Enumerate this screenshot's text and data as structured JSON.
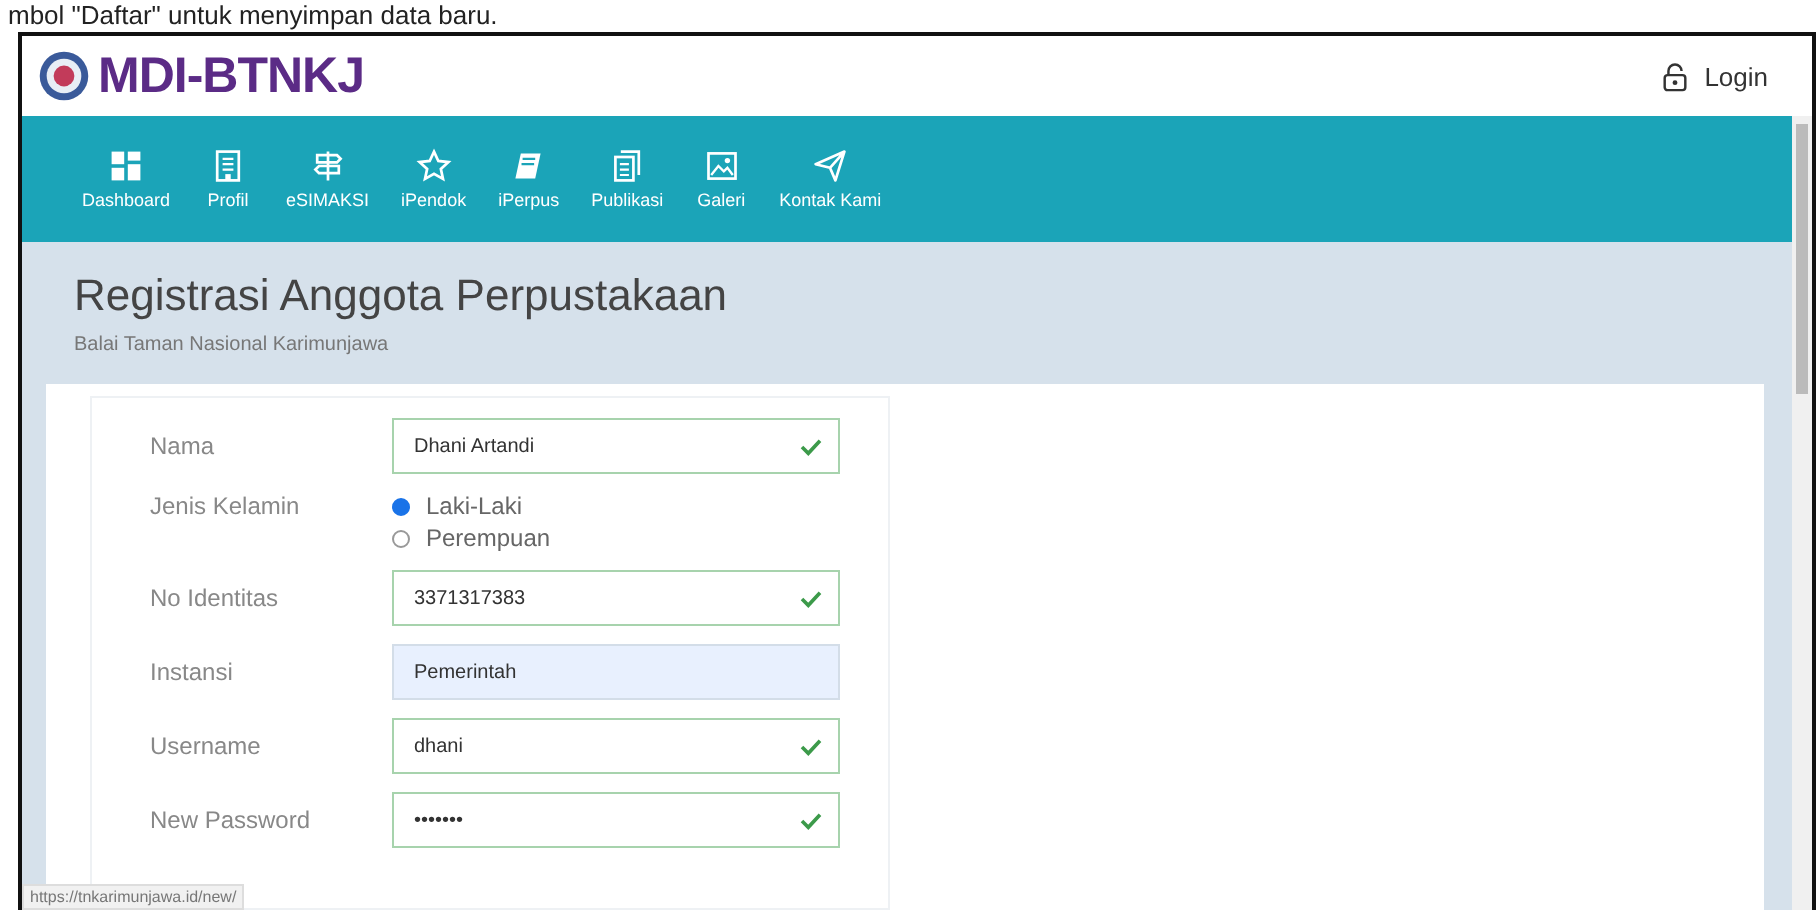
{
  "caption": "mbol \"Daftar\" untuk menyimpan data baru.",
  "header": {
    "logo": "MDI-BTNKJ",
    "login": "Login"
  },
  "nav": [
    {
      "label": "Dashboard"
    },
    {
      "label": "Profil"
    },
    {
      "label": "eSIMAKSI"
    },
    {
      "label": "iPendok"
    },
    {
      "label": "iPerpus"
    },
    {
      "label": "Publikasi"
    },
    {
      "label": "Galeri"
    },
    {
      "label": "Kontak Kami"
    }
  ],
  "page": {
    "title": "Registrasi Anggota Perpustakaan",
    "subtitle": "Balai Taman Nasional Karimunjawa"
  },
  "form": [
    {
      "kind": "text",
      "label": "Nama",
      "value": "Dhani Artandi",
      "valid": true,
      "autofilled": false
    },
    {
      "kind": "radio",
      "label": "Jenis Kelamin",
      "options": [
        {
          "label": "Laki-Laki",
          "selected": true
        },
        {
          "label": "Perempuan",
          "selected": false
        }
      ]
    },
    {
      "kind": "text",
      "label": "No Identitas",
      "value": "3371317383",
      "valid": true,
      "autofilled": false
    },
    {
      "kind": "text",
      "label": "Instansi",
      "value": "Pemerintah",
      "valid": false,
      "autofilled": true
    },
    {
      "kind": "text",
      "label": "Username",
      "value": "dhani",
      "valid": true,
      "autofilled": false
    },
    {
      "kind": "text",
      "label": "New Password",
      "value": "•••••••",
      "valid": true,
      "autofilled": false
    }
  ],
  "status_url": "https://tnkarimunjawa.id/new/"
}
